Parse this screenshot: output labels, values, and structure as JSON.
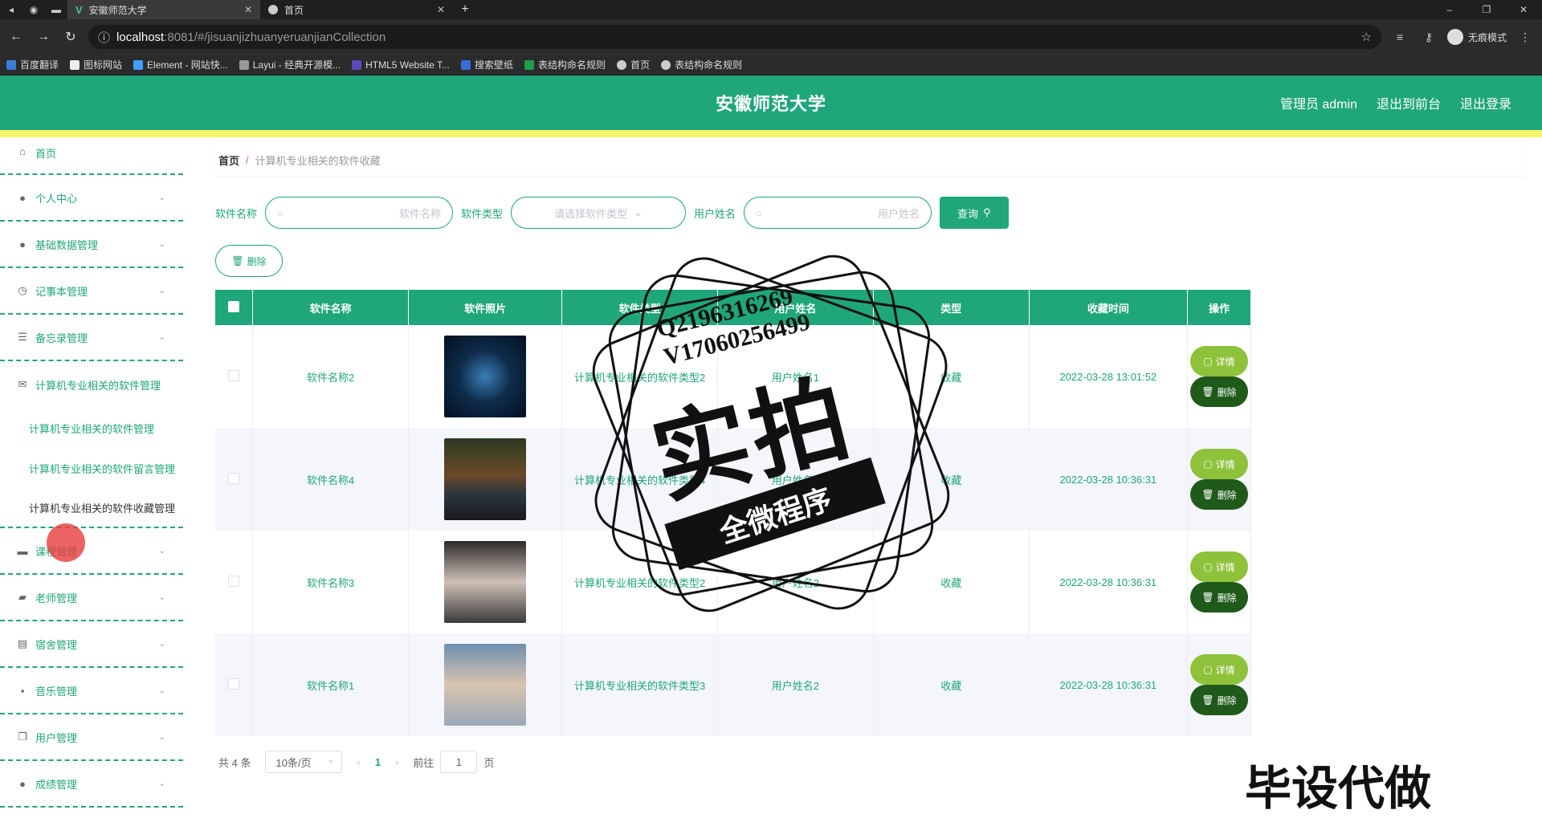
{
  "browser": {
    "tabs": [
      {
        "title": "安徽师范大学",
        "active": true
      },
      {
        "title": "首页",
        "active": false
      }
    ],
    "url_host": "localhost",
    "url_path": ":8081/#/jisuanjizhuanyeruanjianCollection",
    "incognito_label": "无痕模式",
    "bookmarks": [
      "百度翻译",
      "图标网站",
      "Element - 网站快...",
      "Layui - 经典开源模...",
      "HTML5 Website T...",
      "搜索壁纸",
      "表结构命名规则",
      "首页",
      "表结构命名规则"
    ]
  },
  "header": {
    "title": "安徽师范大学",
    "admin": "管理员 admin",
    "to_front": "退出到前台",
    "logout": "退出登录",
    "color": "#1fa67a"
  },
  "sidebar": {
    "items": [
      {
        "label": "首页",
        "icon": "home-icon"
      },
      {
        "label": "个人中心",
        "icon": "user-icon"
      },
      {
        "label": "基础数据管理",
        "icon": "user-icon"
      },
      {
        "label": "记事本管理",
        "icon": "clock-icon"
      },
      {
        "label": "备忘录管理",
        "icon": "sliders-icon"
      },
      {
        "label": "计算机专业相关的软件管理",
        "icon": "mail-icon"
      }
    ],
    "subitems": [
      "计算机专业相关的软件管理",
      "计算机专业相关的软件留言管理",
      "计算机专业相关的软件收藏管理"
    ],
    "items_after": [
      {
        "label": "课程管理",
        "icon": "briefcase-icon"
      },
      {
        "label": "老师管理",
        "icon": "teacher-icon"
      },
      {
        "label": "宿舍管理",
        "icon": "building-icon"
      },
      {
        "label": "音乐管理",
        "icon": "music-icon"
      },
      {
        "label": "用户管理",
        "icon": "users-icon"
      },
      {
        "label": "成绩管理",
        "icon": "user-icon"
      }
    ]
  },
  "breadcrumb": {
    "home": "首页",
    "sep": "/",
    "current": "计算机专业相关的软件收藏"
  },
  "search": {
    "name_label": "软件名称",
    "name_placeholder": "软件名称",
    "type_label": "软件类型",
    "type_placeholder": "请选择软件类型",
    "user_label": "用户姓名",
    "user_placeholder": "用户姓名",
    "query_label": "查询"
  },
  "delete_label": "删除",
  "table": {
    "headers": [
      "软件名称",
      "软件照片",
      "软件类型",
      "用户姓名",
      "类型",
      "收藏时间",
      "操作"
    ],
    "rows": [
      {
        "name": "软件名称2",
        "type": "计算机专业相关的软件类型2",
        "user": "用户姓名1",
        "kind": "收藏",
        "time": "2022-03-28 13:01:52"
      },
      {
        "name": "软件名称4",
        "type": "计算机专业相关的软件类型4",
        "user": "用户姓名1",
        "kind": "收藏",
        "time": "2022-03-28 10:36:31"
      },
      {
        "name": "软件名称3",
        "type": "计算机专业相关的软件类型2",
        "user": "用户姓名2",
        "kind": "收藏",
        "time": "2022-03-28 10:36:31"
      },
      {
        "name": "软件名称1",
        "type": "计算机专业相关的软件类型3",
        "user": "用户姓名2",
        "kind": "收藏",
        "time": "2022-03-28 10:36:31"
      }
    ],
    "detail_label": "详情",
    "del_label": "删除"
  },
  "pager": {
    "total": "共 4 条",
    "size": "10条/页",
    "page": "1",
    "goto": "前往",
    "goto_value": "1",
    "page_suffix": "页"
  },
  "watermark": {
    "line1": "Q2196316269",
    "line2": "V17060256499",
    "big": "实拍",
    "ribbon": "全微程序",
    "corner": "毕设代做"
  }
}
